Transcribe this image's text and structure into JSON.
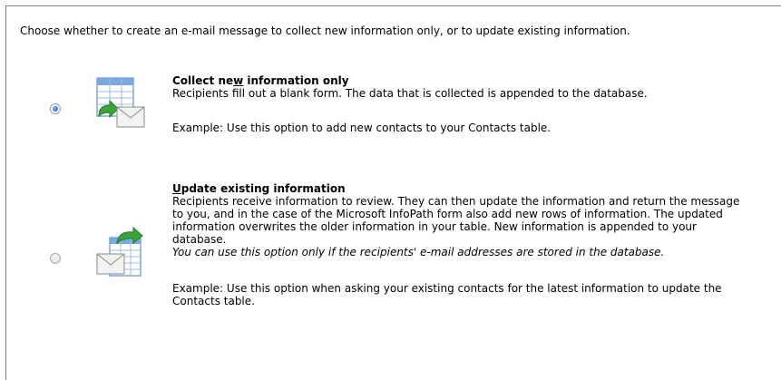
{
  "intro": "Choose whether to create an e-mail message to collect new information only, or to update existing information.",
  "options": [
    {
      "title_pre": "Collect ne",
      "title_u": "w",
      "title_post": " information only",
      "selected": true,
      "description": "Recipients fill out a blank form. The data that is collected is appended to the database.",
      "example": "Example: Use this option to add new contacts to your Contacts table.",
      "icon": "table-with-email-icon"
    },
    {
      "title_u": "U",
      "title_post": "pdate existing information",
      "selected": false,
      "description_lines": [
        "Recipients receive information to review. They can then update the information and return the message",
        "to you, and in the case of the Microsoft InfoPath form also add new rows of information.  The updated",
        "information overwrites the older information in your table.  New information is appended to your",
        "database."
      ],
      "note": "You can use this option only if the recipients' e-mail addresses are stored in the database.",
      "example_lines": [
        "Example: Use this option when asking your existing contacts for the latest information to update the",
        "Contacts table."
      ],
      "icon": "email-with-table-refresh-icon"
    }
  ],
  "colors": {
    "table_blue": "#7aa7de",
    "arrow_green": "#3aa53a",
    "envelope": "#f2f2f2"
  }
}
